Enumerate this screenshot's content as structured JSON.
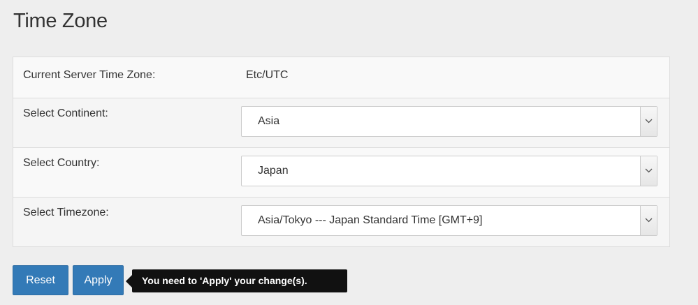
{
  "page": {
    "title": "Time Zone"
  },
  "current": {
    "label": "Current Server Time Zone:",
    "value": "Etc/UTC"
  },
  "continent": {
    "label": "Select Continent:",
    "selected": "Asia",
    "caret_icon": "chevron-down-icon"
  },
  "country": {
    "label": "Select Country:",
    "selected": "Japan",
    "caret_icon": "chevron-down-icon"
  },
  "timezone": {
    "label": "Select Timezone:",
    "selected": "Asia/Tokyo --- Japan Standard Time [GMT+9]",
    "caret_icon": "chevron-down-icon"
  },
  "actions": {
    "reset_label": "Reset",
    "apply_label": "Apply",
    "tooltip_text": "You need to 'Apply' your change(s).",
    "button_color": "#337ab7",
    "tooltip_color": "#111111"
  }
}
